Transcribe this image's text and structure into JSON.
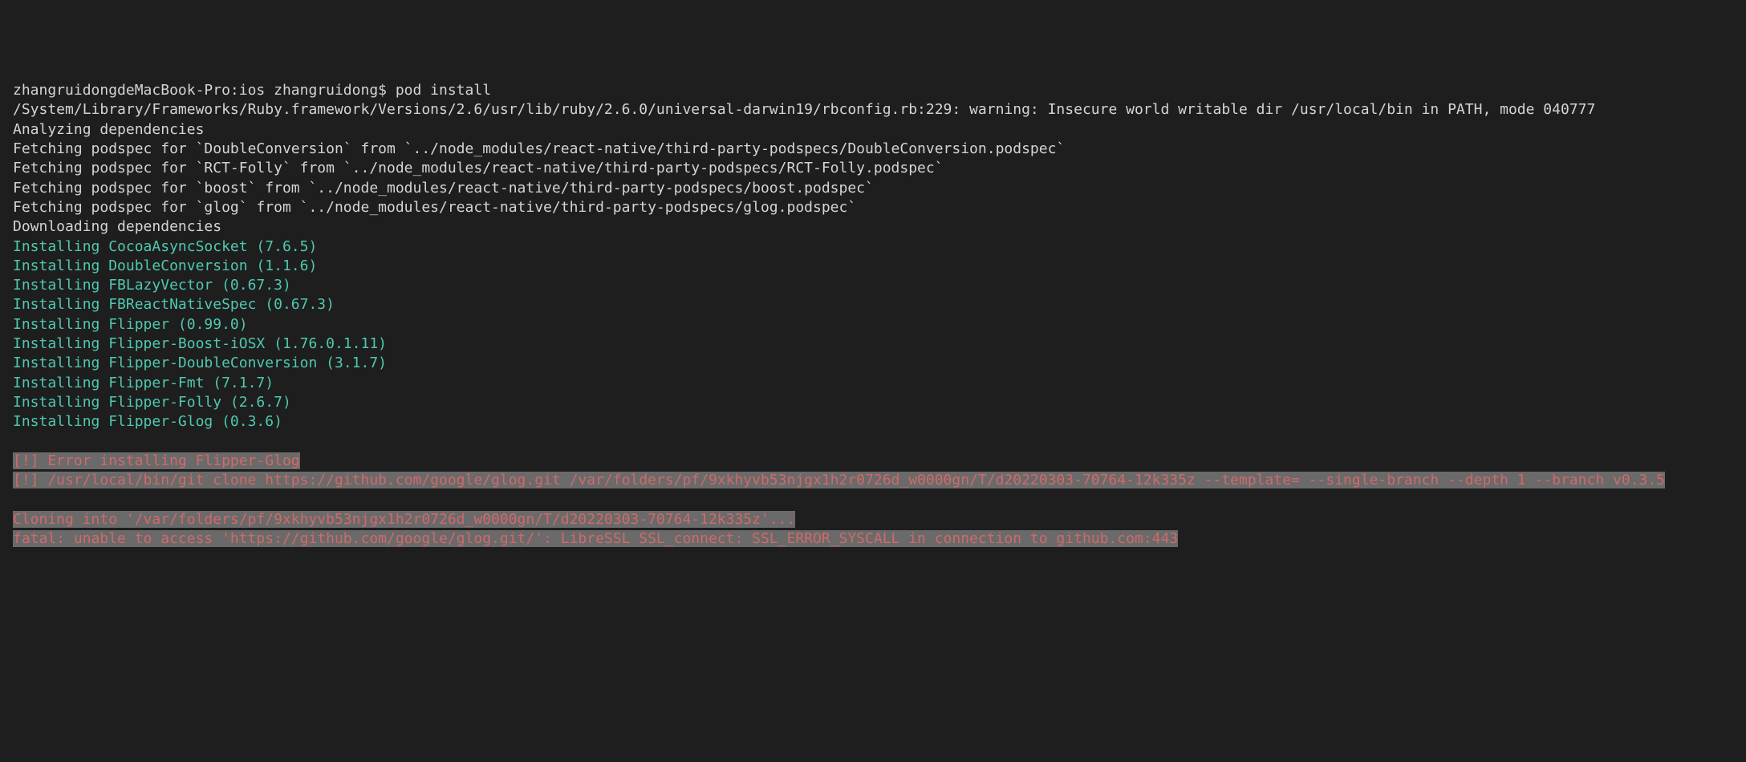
{
  "prompt_line": "zhangruidongdeMacBook-Pro:ios zhangruidong$ pod install",
  "warning_line": "/System/Library/Frameworks/Ruby.framework/Versions/2.6/usr/lib/ruby/2.6.0/universal-darwin19/rbconfig.rb:229: warning: Insecure world writable dir /usr/local/bin in PATH, mode 040777",
  "analyzing": "Analyzing dependencies",
  "fetch1": "Fetching podspec for `DoubleConversion` from `../node_modules/react-native/third-party-podspecs/DoubleConversion.podspec`",
  "fetch2": "Fetching podspec for `RCT-Folly` from `../node_modules/react-native/third-party-podspecs/RCT-Folly.podspec`",
  "fetch3": "Fetching podspec for `boost` from `../node_modules/react-native/third-party-podspecs/boost.podspec`",
  "fetch4": "Fetching podspec for `glog` from `../node_modules/react-native/third-party-podspecs/glog.podspec`",
  "downloading": "Downloading dependencies",
  "install1": "Installing CocoaAsyncSocket (7.6.5)",
  "install2": "Installing DoubleConversion (1.1.6)",
  "install3": "Installing FBLazyVector (0.67.3)",
  "install4": "Installing FBReactNativeSpec (0.67.3)",
  "install5": "Installing Flipper (0.99.0)",
  "install6": "Installing Flipper-Boost-iOSX (1.76.0.1.11)",
  "install7": "Installing Flipper-DoubleConversion (3.1.7)",
  "install8": "Installing Flipper-Fmt (7.1.7)",
  "install9": "Installing Flipper-Folly (2.6.7)",
  "install10": "Installing Flipper-Glog (0.3.6)",
  "error1": "[!] Error installing Flipper-Glog",
  "error2": "[!] /usr/local/bin/git clone https://github.com/google/glog.git /var/folders/pf/9xkhyvb53njgx1h2r0726d_w0000gn/T/d20220303-70764-12k335z --template= --single-branch --depth 1 --branch v0.3.5",
  "error3": "Cloning into '/var/folders/pf/9xkhyvb53njgx1h2r0726d_w0000gn/T/d20220303-70764-12k335z'...",
  "error4": "fatal: unable to access 'https://github.com/google/glog.git/': LibreSSL SSL_connect: SSL_ERROR_SYSCALL in connection to github.com:443"
}
